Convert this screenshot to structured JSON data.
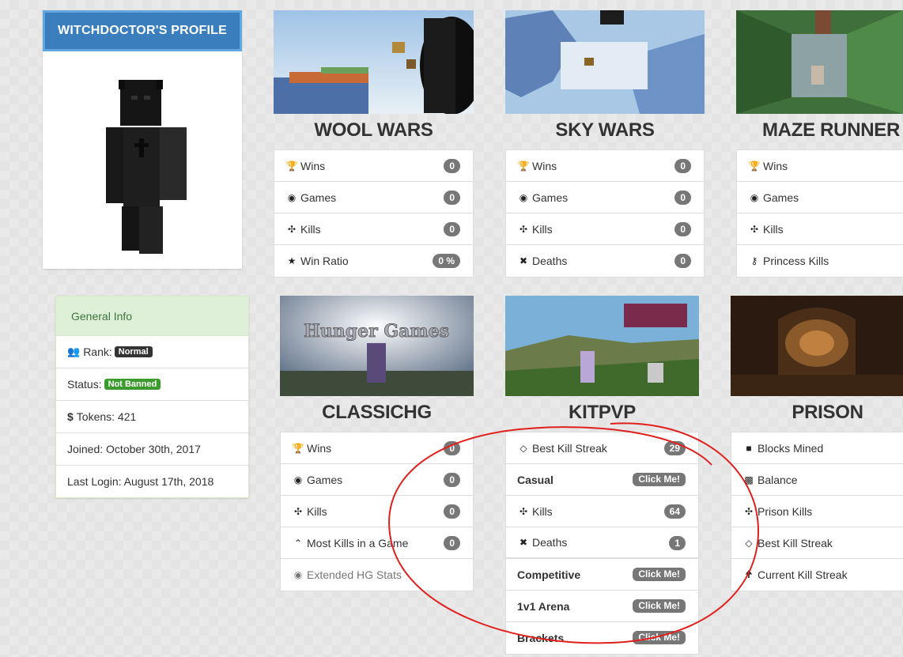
{
  "profile": {
    "title": "WITCHDOCTOR'S PROFILE"
  },
  "general_info": {
    "heading": "General Info",
    "rank_label": "Rank:",
    "rank_value": "Normal",
    "status_label": "Status:",
    "status_value": "Not Banned",
    "tokens": "Tokens: 421",
    "joined": "Joined: October 30th, 2017",
    "last_login": "Last Login: August 17th, 2018"
  },
  "games": {
    "wool_wars": {
      "title": "WOOL WARS",
      "rows": [
        {
          "icon": "trophy-icon",
          "label": "Wins",
          "value": "0"
        },
        {
          "icon": "gamepad-icon",
          "label": "Games",
          "value": "0"
        },
        {
          "icon": "crosshair-icon",
          "label": "Kills",
          "value": "0"
        },
        {
          "icon": "star-icon",
          "label": "Win Ratio",
          "value": "0 %"
        }
      ]
    },
    "sky_wars": {
      "title": "SKY WARS",
      "rows": [
        {
          "icon": "trophy-icon",
          "label": "Wins",
          "value": "0"
        },
        {
          "icon": "gamepad-icon",
          "label": "Games",
          "value": "0"
        },
        {
          "icon": "crosshair-icon",
          "label": "Kills",
          "value": "0"
        },
        {
          "icon": "x-icon",
          "label": "Deaths",
          "value": "0"
        }
      ]
    },
    "maze_runner": {
      "title": "MAZE RUNNER",
      "rows": [
        {
          "icon": "trophy-icon",
          "label": "Wins"
        },
        {
          "icon": "gamepad-icon",
          "label": "Games"
        },
        {
          "icon": "crosshair-icon",
          "label": "Kills"
        },
        {
          "icon": "key-icon",
          "label": "Princess Kills"
        }
      ]
    },
    "classichg": {
      "title": "CLASSICHG",
      "rows": [
        {
          "icon": "trophy-icon",
          "label": "Wins",
          "value": "0"
        },
        {
          "icon": "gamepad-icon",
          "label": "Games",
          "value": "0"
        },
        {
          "icon": "crosshair-icon",
          "label": "Kills",
          "value": "0"
        },
        {
          "icon": "double-chevron-up-icon",
          "label": "Most Kills in a Game",
          "value": "0"
        }
      ],
      "extended_link": "Extended HG Stats"
    },
    "kitpvp": {
      "title": "KITPVP",
      "best_kill_streak": {
        "label": "Best Kill Streak",
        "value": "29"
      },
      "casual": {
        "label": "Casual",
        "button": "Click Me!"
      },
      "kills": {
        "label": "Kills",
        "value": "64"
      },
      "deaths": {
        "label": "Deaths",
        "value": "1"
      },
      "competitive": {
        "label": "Competitive",
        "button": "Click Me!"
      },
      "arena": {
        "label": "1v1 Arena",
        "button": "Click Me!"
      },
      "brackets": {
        "label": "Brackets",
        "button": "Click Me!"
      }
    },
    "prison": {
      "title": "PRISON",
      "rows": [
        {
          "icon": "square-icon",
          "label": "Blocks Mined"
        },
        {
          "icon": "money-icon",
          "label": "Balance"
        },
        {
          "icon": "crosshair-icon",
          "label": "Prison Kills"
        },
        {
          "icon": "diamond-icon",
          "label": "Best Kill Streak"
        },
        {
          "icon": "arrow-up-icon",
          "label": "Current Kill Streak"
        }
      ]
    }
  },
  "colors": {
    "header_blue": "#3a7ebe",
    "rank_badge": "#333333",
    "status_badge": "#3c9b2f",
    "annotation_red": "#e0201c",
    "badge_gray": "#777777"
  },
  "hunger_games_banner": "Hunger Games"
}
